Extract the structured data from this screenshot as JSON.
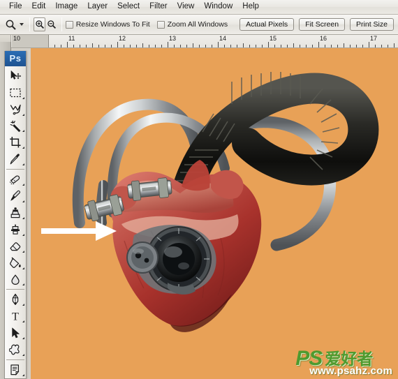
{
  "app": {
    "name": "Adobe Photoshop",
    "logo_text": "Ps"
  },
  "menubar": {
    "items": [
      {
        "label": "File",
        "name": "menu-file"
      },
      {
        "label": "Edit",
        "name": "menu-edit"
      },
      {
        "label": "Image",
        "name": "menu-image"
      },
      {
        "label": "Layer",
        "name": "menu-layer"
      },
      {
        "label": "Select",
        "name": "menu-select"
      },
      {
        "label": "Filter",
        "name": "menu-filter"
      },
      {
        "label": "View",
        "name": "menu-view"
      },
      {
        "label": "Window",
        "name": "menu-window"
      },
      {
        "label": "Help",
        "name": "menu-help"
      }
    ]
  },
  "options_bar": {
    "active_tool_icon": "zoom-tool-icon",
    "preset_caret": "chevron-down-icon",
    "zoom_in_icon": "zoom-in-icon",
    "zoom_out_icon": "zoom-out-icon",
    "checkboxes": [
      {
        "label": "Resize Windows To Fit",
        "checked": false
      },
      {
        "label": "Zoom All Windows",
        "checked": false
      }
    ],
    "buttons": [
      {
        "label": "Actual Pixels"
      },
      {
        "label": "Fit Screen"
      },
      {
        "label": "Print Size"
      }
    ]
  },
  "ruler": {
    "unit": "inches",
    "labels": [
      "10",
      "11",
      "12",
      "13",
      "14",
      "15",
      "16",
      "17"
    ],
    "collapse_icon": "double-chevron-right-icon"
  },
  "toolbar": {
    "tools": [
      {
        "name": "move-tool",
        "label": "Move Tool",
        "has_flyout": false
      },
      {
        "name": "rectangular-marquee-tool",
        "label": "Rectangular Marquee Tool",
        "has_flyout": true
      },
      {
        "name": "lasso-tool",
        "label": "Lasso Tool",
        "has_flyout": true
      },
      {
        "name": "magic-wand-tool",
        "label": "Magic Wand Tool",
        "has_flyout": true
      },
      {
        "name": "crop-tool",
        "label": "Crop Tool",
        "has_flyout": true
      },
      {
        "name": "eyedropper-tool",
        "label": "Eyedropper Tool",
        "has_flyout": true
      },
      {
        "name": "healing-brush-tool",
        "label": "Spot Healing Brush Tool",
        "has_flyout": true
      },
      {
        "name": "brush-tool",
        "label": "Brush Tool",
        "has_flyout": true
      },
      {
        "name": "clone-stamp-tool",
        "label": "Clone Stamp Tool",
        "has_flyout": true
      },
      {
        "name": "history-brush-tool",
        "label": "History Brush Tool",
        "has_flyout": true
      },
      {
        "name": "eraser-tool",
        "label": "Eraser Tool",
        "has_flyout": true
      },
      {
        "name": "gradient-tool",
        "label": "Paint Bucket Tool",
        "has_flyout": true
      },
      {
        "name": "blur-tool",
        "label": "Blur Tool",
        "has_flyout": true
      },
      {
        "name": "dodge-tool",
        "label": "Dodge Tool",
        "has_flyout": true
      },
      {
        "name": "pen-tool",
        "label": "Pen Tool",
        "has_flyout": true
      },
      {
        "name": "type-tool",
        "label": "Horizontal Type Tool",
        "has_flyout": true
      },
      {
        "name": "path-selection-tool",
        "label": "Path Selection Tool",
        "has_flyout": true
      },
      {
        "name": "custom-shape-tool",
        "label": "Custom Shape Tool",
        "has_flyout": true
      },
      {
        "name": "notes-tool",
        "label": "Notes Tool",
        "has_flyout": true
      }
    ],
    "type_tool_glyph": "T"
  },
  "canvas": {
    "background_color": "#e8a157",
    "artwork_description": "Anatomical heart fused with chrome pipes, a black corrugated hose and a camera lens",
    "annotation": {
      "type": "arrow",
      "name": "pointer-arrow",
      "color": "#ffffff",
      "points_to": "camera-viewfinder-knob"
    }
  },
  "watermark": {
    "brand": "PS",
    "brand_cn": "爱好者",
    "url": "www.psahz.com",
    "color": "#4e9a2f"
  }
}
